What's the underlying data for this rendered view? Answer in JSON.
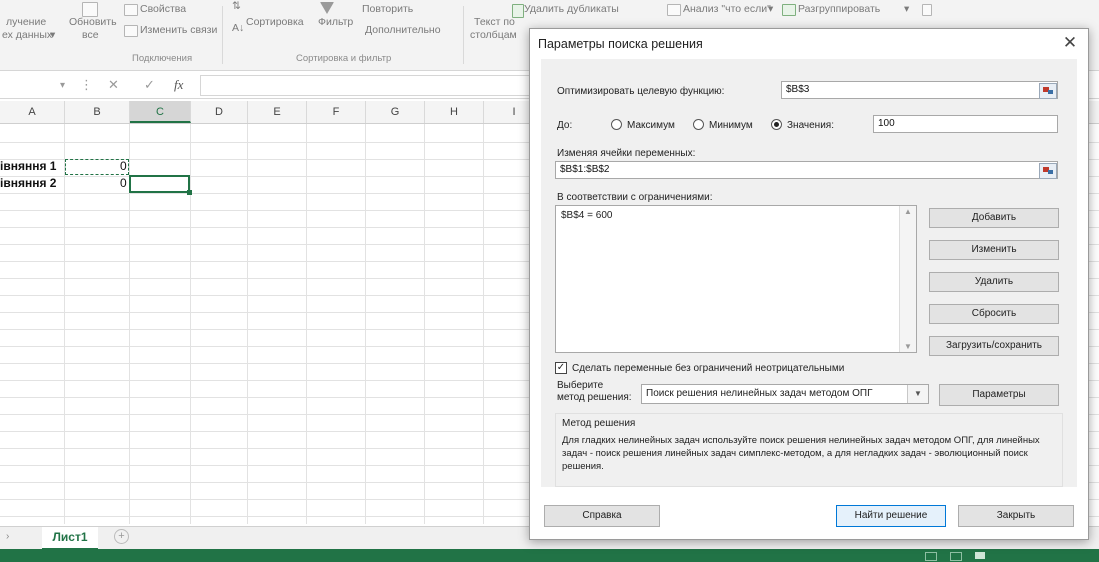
{
  "ribbon": {
    "get_data_1": "лучение",
    "get_data_2": "ех данных",
    "refresh_1": "Обновить",
    "refresh_2": "все",
    "properties": "Свойства",
    "edit_links": "Изменить связи",
    "connections_group": "Подключения",
    "sort": "Сортировка",
    "filter": "Фильтр",
    "reapply": "Повторить",
    "advanced": "Дополнительно",
    "sort_filter_group": "Сортировка и фильтр",
    "text_to_col_1": "Текст по",
    "text_to_col_2": "столбцам",
    "remove_dupes": "Удалить дубликаты",
    "what_if": "Анализ \"что если\"",
    "ungroup": "Разгруппировать"
  },
  "formula_bar": {
    "fx": "fx",
    "cancel": "✕",
    "enter": "✓"
  },
  "columns": [
    "A",
    "B",
    "C",
    "D",
    "E",
    "F",
    "G",
    "H",
    "I"
  ],
  "cells": {
    "a3": "івняння 1",
    "a4": "івняння 2",
    "b3": "0",
    "b4": "0"
  },
  "sheet_tab": "Лист1",
  "dialog": {
    "title": "Параметры поиска решения",
    "objective_label": "Оптимизировать целевую функцию:",
    "objective_value": "$B$3",
    "to_label": "До:",
    "max_label": "Максимум",
    "min_label": "Минимум",
    "value_of_label": "Значения:",
    "value_of_input": "100",
    "selected_option": "value_of",
    "changing_label": "Изменяя ячейки переменных:",
    "changing_value": "$B$1:$B$2",
    "constraints_label": "В соответствии с ограничениями:",
    "constraints": [
      "$B$4 = 600"
    ],
    "add_button": "Добавить",
    "change_button": "Изменить",
    "delete_button": "Удалить",
    "reset_button": "Сбросить",
    "load_save_button": "Загрузить/сохранить",
    "nonneg_label": "Сделать переменные без ограничений неотрицательными",
    "nonneg_checked": true,
    "method_label_1": "Выберите",
    "method_label_2": "метод решения:",
    "method_value": "Поиск решения нелинейных задач методом ОПГ",
    "options_button": "Параметры",
    "method_group_title": "Метод решения",
    "method_desc": "Для гладких нелинейных задач используйте поиск решения нелинейных задач методом ОПГ, для линейных задач - поиск решения линейных задач симплекс-методом, а для негладких задач - эволюционный поиск решения.",
    "help_button": "Справка",
    "solve_button": "Найти решение",
    "close_button": "Закрыть"
  },
  "colors": {
    "excel_green": "#217346",
    "default_button_border": "#0078d7"
  }
}
